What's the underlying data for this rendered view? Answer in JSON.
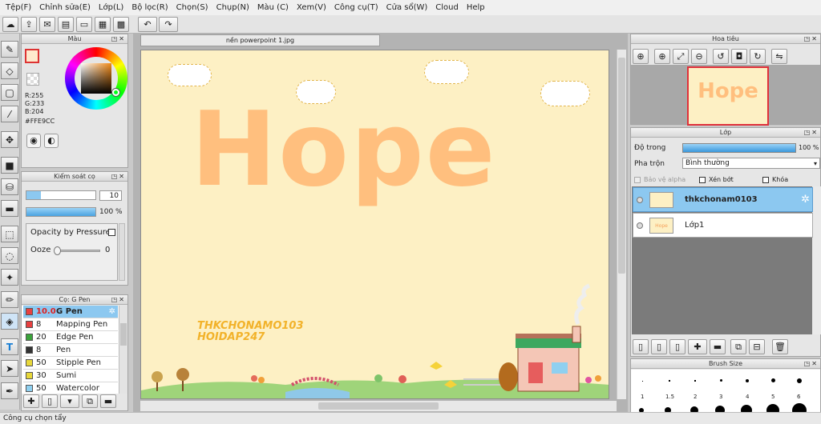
{
  "menu": [
    "Tệp(F)",
    "Chỉnh sửa(E)",
    "Lớp(L)",
    "Bộ lọc(R)",
    "Chọn(S)",
    "Chụp(N)",
    "Màu (C)",
    "Xem(V)",
    "Công cụ(T)",
    "Cửa sổ(W)",
    "Cloud",
    "Help"
  ],
  "panels": {
    "color_title": "Màu",
    "color_r": "R:255",
    "color_g": "G:233",
    "color_b": "B:204",
    "color_hex": "#FFE9CC",
    "brush_control_title": "Kiểm soát cọ",
    "brush_size_value": "10",
    "brush_opacity_value": "100 %",
    "opacity_pressure_label": "Opacity by Pressure",
    "ooze_label": "Ooze",
    "ooze_value": "0",
    "brush_list_title": "Cọ: G Pen",
    "navigator_title": "Hoa tiêu",
    "layer_title": "Lớp",
    "layer_opacity_label": "Độ trong",
    "layer_opacity_value": "100 %",
    "blend_label": "Pha trộn",
    "blend_value": "Bình thường",
    "protect_alpha_label": "Bảo vệ alpha",
    "clip_label": "Xén bớt",
    "lock_label": "Khóa",
    "brush_size_title": "Brush Size"
  },
  "brushes": [
    {
      "size": "10.0",
      "name": "G Pen",
      "color": "#e84040",
      "selected": true
    },
    {
      "size": "8",
      "name": "Mapping Pen",
      "color": "#e84040",
      "selected": false
    },
    {
      "size": "20",
      "name": "Edge Pen",
      "color": "#3aa33a",
      "selected": false
    },
    {
      "size": "8",
      "name": "Pen",
      "color": "#333333",
      "selected": false
    },
    {
      "size": "50",
      "name": "Stipple Pen",
      "color": "#e8d83a",
      "selected": false
    },
    {
      "size": "30",
      "name": "Sumi",
      "color": "#e8d83a",
      "selected": false
    },
    {
      "size": "50",
      "name": "Watercolor",
      "color": "#8fd0f0",
      "selected": false
    }
  ],
  "layers": [
    {
      "name": "thkchonam0103",
      "selected": true
    },
    {
      "name": "Lớp1",
      "selected": false
    }
  ],
  "brush_sizes": [
    "1",
    "1.5",
    "2",
    "3",
    "4",
    "5",
    "6"
  ],
  "document": {
    "tab": "nền powerpoint 1.jpg",
    "hope_text": "Hope",
    "watermark_line1": "THKCHONAMO103",
    "watermark_line2": "HOIDAP247"
  },
  "status": "Công cụ chọn tẩy",
  "colors": {
    "accent": "#8cc8f0",
    "fg_color": "#FFE9CC",
    "canvas_bg": "#fdf0c4",
    "hope": "#ffbf7e"
  }
}
